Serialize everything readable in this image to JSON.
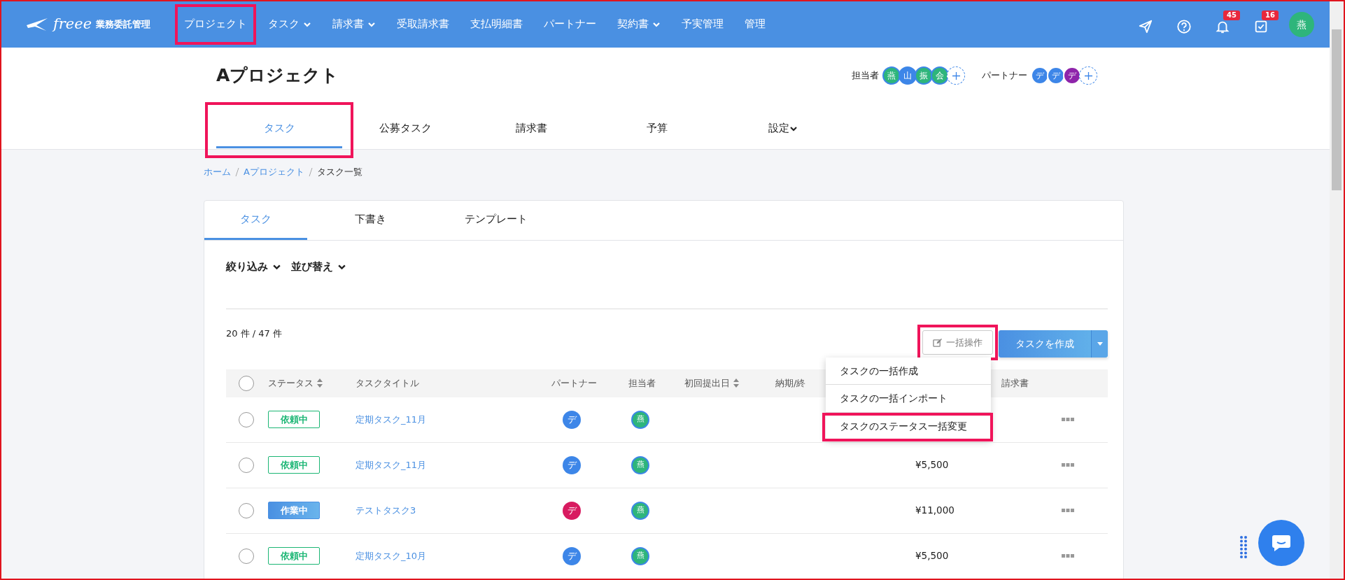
{
  "nav": {
    "brand": "freee",
    "product": "業務委託管理",
    "items": [
      {
        "label": "プロジェクト",
        "dropdown": false,
        "highlighted": true
      },
      {
        "label": "タスク",
        "dropdown": true,
        "highlighted": false
      },
      {
        "label": "請求書",
        "dropdown": true,
        "highlighted": false
      },
      {
        "label": "受取請求書",
        "dropdown": false,
        "highlighted": false
      },
      {
        "label": "支払明細書",
        "dropdown": false,
        "highlighted": false
      },
      {
        "label": "パートナー",
        "dropdown": false,
        "highlighted": false
      },
      {
        "label": "契約書",
        "dropdown": true,
        "highlighted": false
      },
      {
        "label": "予実管理",
        "dropdown": false,
        "highlighted": false
      },
      {
        "label": "管理",
        "dropdown": false,
        "highlighted": false
      }
    ],
    "icons": [
      {
        "kind": "send"
      },
      {
        "kind": "help"
      },
      {
        "kind": "bell",
        "count": "45"
      },
      {
        "kind": "inbox",
        "count": "16"
      }
    ],
    "user_avatar": {
      "initial": "燕",
      "color": "#2eb57b"
    }
  },
  "project": {
    "title": "Aプロジェクト",
    "assignees_label": "担当者",
    "assignees": [
      {
        "initial": "燕",
        "color": "#2eb57b"
      },
      {
        "initial": "山",
        "color": "#3d86e8"
      },
      {
        "initial": "振",
        "color": "#2eb57b"
      },
      {
        "initial": "会",
        "color": "#2eb57b"
      }
    ],
    "partners_label": "パートナー",
    "partners": [
      {
        "initial": "デ",
        "color": "#3d86e8"
      },
      {
        "initial": "デ",
        "color": "#3d86e8"
      },
      {
        "initial": "デ",
        "color": "#8e24aa"
      }
    ],
    "tabs": [
      {
        "label": "タスク",
        "selected": true,
        "dropdown": false,
        "highlighted": true
      },
      {
        "label": "公募タスク",
        "selected": false,
        "dropdown": false,
        "highlighted": false
      },
      {
        "label": "請求書",
        "selected": false,
        "dropdown": false,
        "highlighted": false
      },
      {
        "label": "予算",
        "selected": false,
        "dropdown": false,
        "highlighted": false
      },
      {
        "label": "設定",
        "selected": false,
        "dropdown": true,
        "highlighted": false
      }
    ]
  },
  "breadcrumb": [
    {
      "label": "ホーム",
      "link": true
    },
    {
      "label": "Aプロジェクト",
      "link": true
    },
    {
      "label": "タスク一覧",
      "link": false
    }
  ],
  "card": {
    "tabs": [
      {
        "label": "タスク",
        "selected": true
      },
      {
        "label": "下書き",
        "selected": false
      },
      {
        "label": "テンプレート",
        "selected": false
      }
    ],
    "filters": [
      "絞り込み",
      "並び替え"
    ],
    "count": "20 件 / 47 件",
    "bulk_button": {
      "label": "一括操作",
      "highlighted": true
    },
    "create_button": "タスクを作成",
    "bulk_menu": [
      {
        "label": "タスクの一括作成",
        "highlighted": false
      },
      {
        "label": "タスクの一括インポート",
        "highlighted": false
      },
      {
        "label": "タスクのステータス一括変更",
        "highlighted": true
      }
    ],
    "table": {
      "select_all": {
        "checked": false
      },
      "columns": [
        {
          "label": "ステータス",
          "sortable": true
        },
        {
          "label": "タスクタイトル",
          "sortable": false
        },
        {
          "label": "パートナー",
          "sortable": false
        },
        {
          "label": "担当者",
          "sortable": false
        },
        {
          "label": "初回提出日",
          "sortable": true
        },
        {
          "label": "納期/終",
          "sortable": false
        },
        {
          "label": "請求書",
          "sortable": false
        }
      ],
      "rows": [
        {
          "checked": false,
          "status": "依頼中",
          "kind": "outline",
          "title": "定期タスク_11月",
          "partner": {
            "initial": "デ",
            "color": "#3d86e8"
          },
          "assignee": {
            "initial": "燕",
            "color": "#2eb57b"
          }
        },
        {
          "checked": false,
          "status": "依頼中",
          "kind": "outline",
          "title": "定期タスク_11月",
          "partner": {
            "initial": "デ",
            "color": "#3d86e8"
          },
          "assignee": {
            "initial": "燕",
            "color": "#2eb57b"
          },
          "amount": "¥5,500"
        },
        {
          "checked": false,
          "status": "作業中",
          "kind": "filled",
          "title": "テストタスク3",
          "partner": {
            "initial": "デ",
            "color": "#d81b60"
          },
          "assignee": {
            "initial": "燕",
            "color": "#2eb57b"
          },
          "amount": "¥11,000"
        },
        {
          "checked": false,
          "status": "依頼中",
          "kind": "outline",
          "title": "定期タスク_10月",
          "partner": {
            "initial": "デ",
            "color": "#3d86e8"
          },
          "assignee": {
            "initial": "燕",
            "color": "#2eb57b"
          },
          "amount": "¥5,500"
        }
      ]
    }
  }
}
